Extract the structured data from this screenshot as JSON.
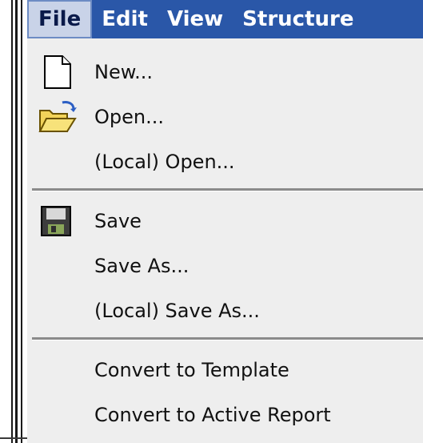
{
  "menubar": {
    "menus": [
      {
        "label": "File"
      },
      {
        "label": "Edit"
      },
      {
        "label": "View"
      },
      {
        "label": "Structure"
      }
    ]
  },
  "file_menu": {
    "items": [
      {
        "label": "New...",
        "icon": "new-document-icon"
      },
      {
        "label": "Open...",
        "icon": "open-folder-icon"
      },
      {
        "label": "(Local) Open...",
        "icon": ""
      },
      {
        "label": "Save",
        "icon": "floppy-disk-icon"
      },
      {
        "label": "Save As...",
        "icon": ""
      },
      {
        "label": "(Local) Save As...",
        "icon": ""
      },
      {
        "label": "Convert to Template",
        "icon": ""
      },
      {
        "label": "Convert to Active Report",
        "icon": ""
      }
    ]
  },
  "colors": {
    "menubar_bg": "#2a57a8",
    "active_menu_bg": "#c9d3e8",
    "dropdown_bg": "#eeeeee",
    "separator": "#8a8a8a"
  }
}
